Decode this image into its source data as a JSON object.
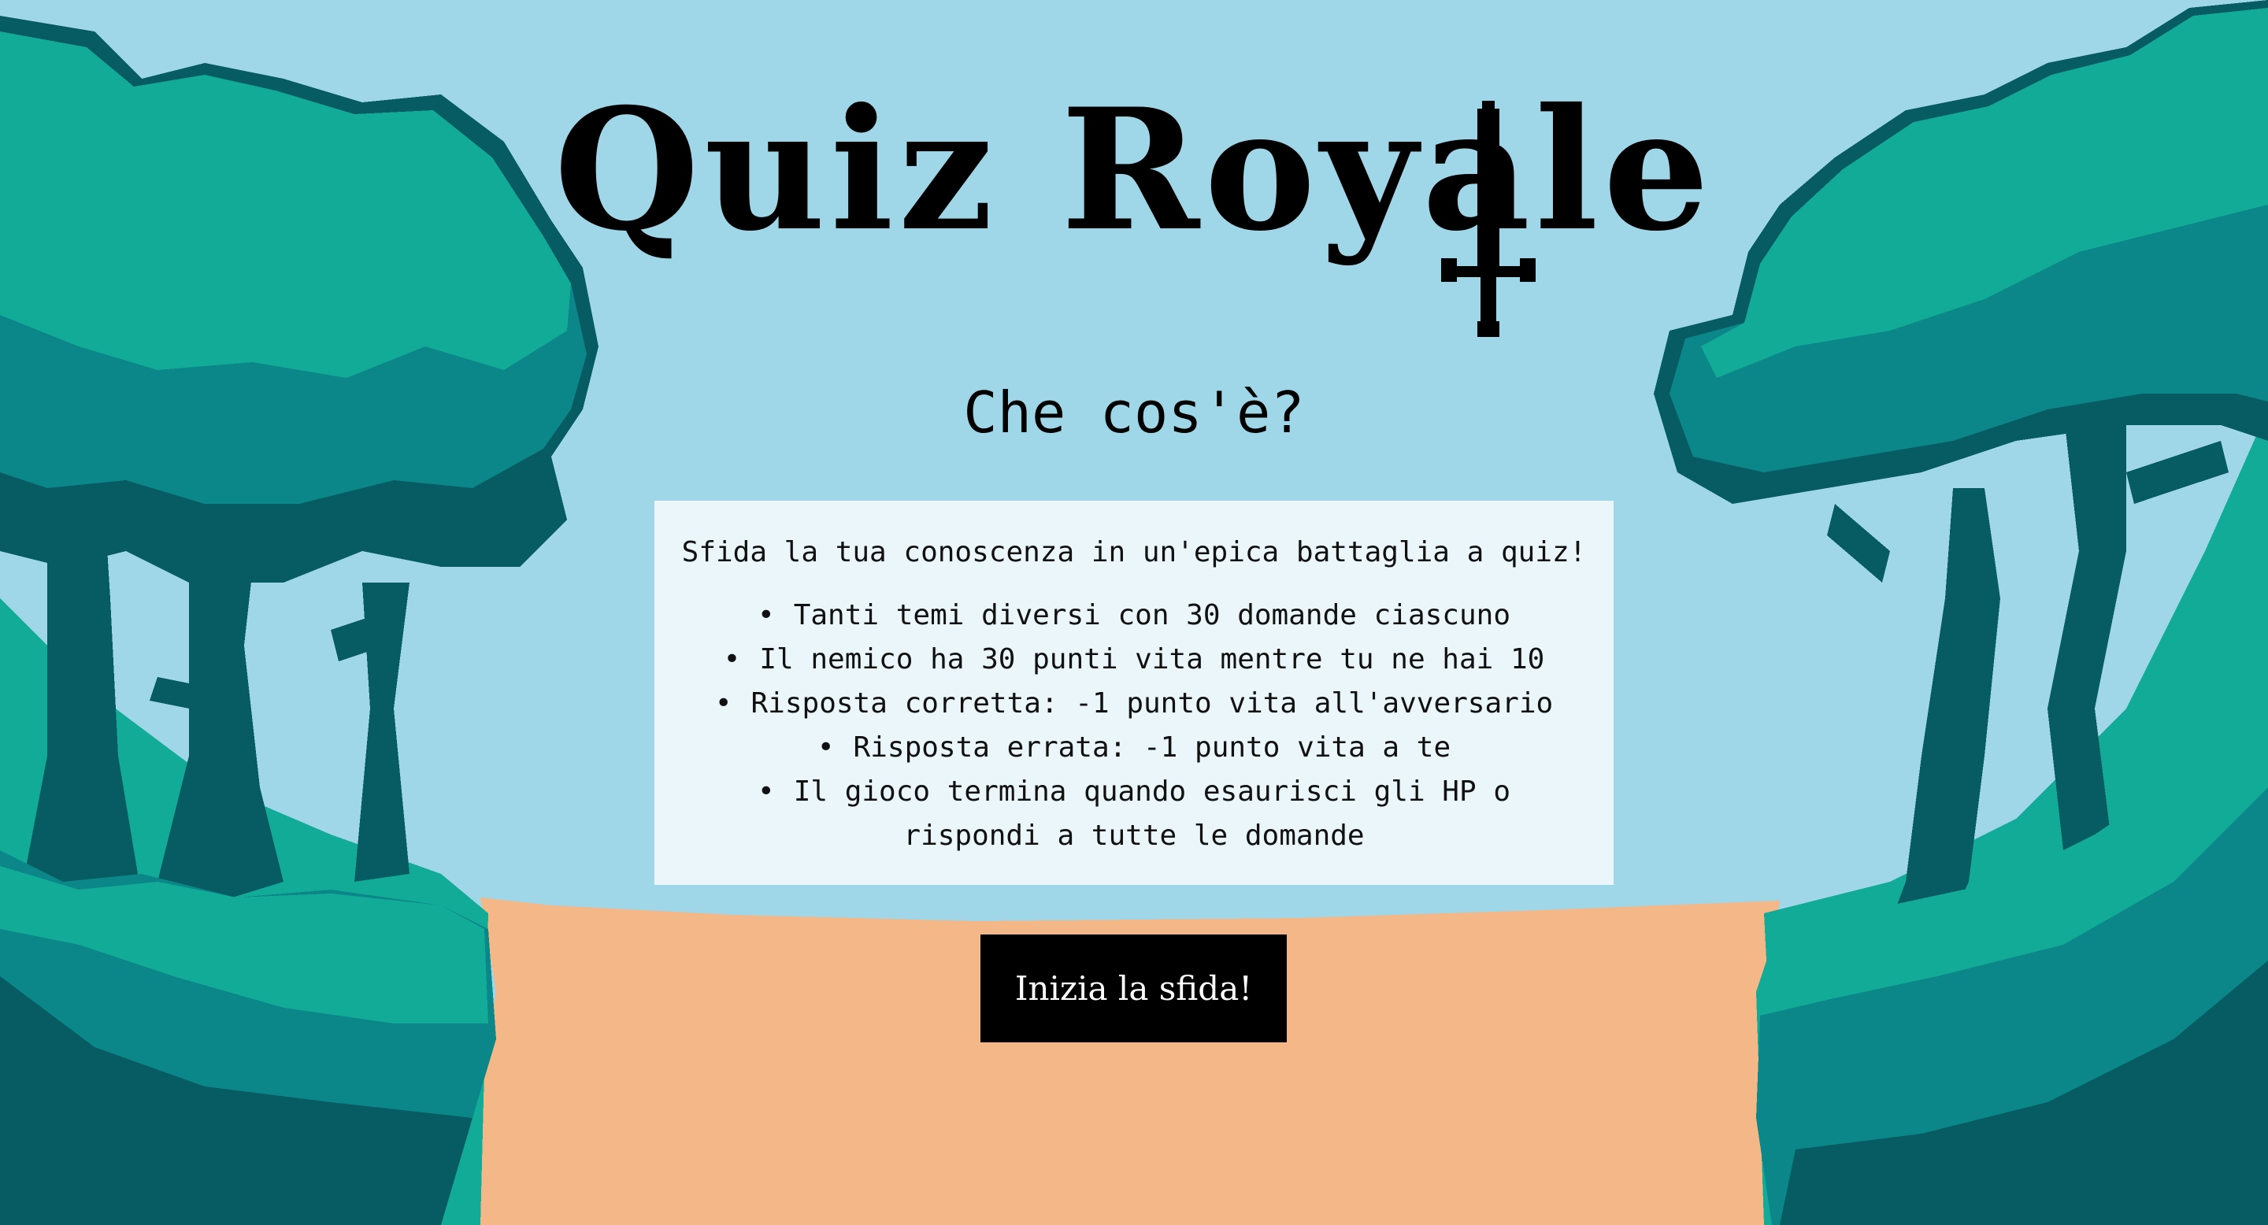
{
  "title": "Quiz Royale",
  "subtitle": "Che cos'è?",
  "info": {
    "intro": "Sfida la tua conoscenza in un'epica battaglia a quiz!",
    "rules": [
      "Tanti temi diversi con 30 domande ciascuno",
      "Il nemico ha 30 punti vita mentre tu ne hai 10",
      "Risposta corretta: -1 punto vita all'avversario",
      "Risposta errata: -1 punto vita a te",
      "Il gioco termina quando esaurisci gli HP o rispondi a tutte le domande"
    ]
  },
  "start_button": "Inizia la sfida!",
  "colors": {
    "sky": "#9fd6e8",
    "path": "#f4b888",
    "tree_light": "#12ab97",
    "tree_mid": "#0c8789",
    "tree_dark": "#075c63",
    "panel": "#eaf6f9",
    "button": "#000000"
  }
}
